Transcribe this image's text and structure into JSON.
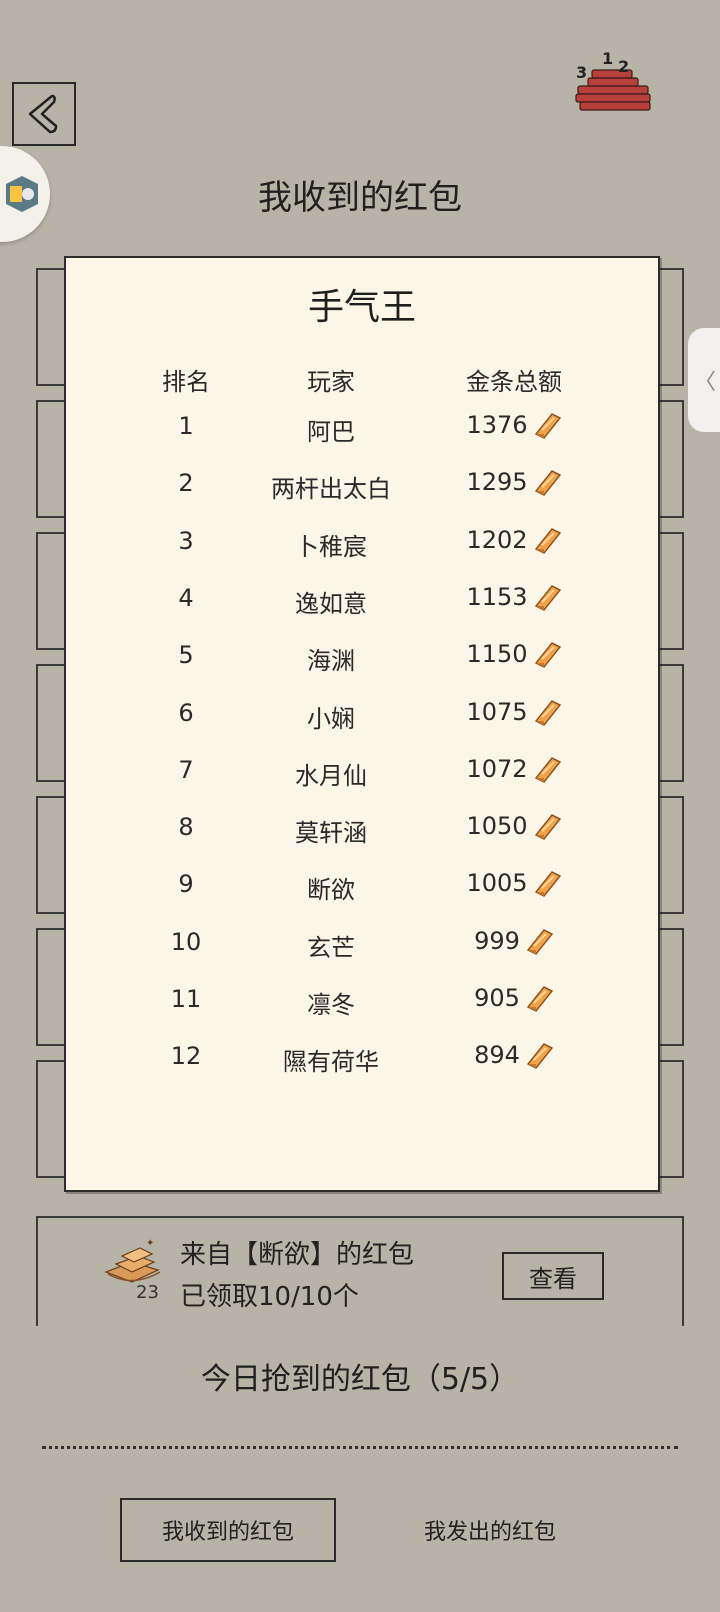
{
  "header": {
    "title": "我收到的红包",
    "back_icon": "back-arrow-icon",
    "rank_icon": "ranking-podium-icon",
    "rank_digits": [
      "3",
      "1",
      "2"
    ]
  },
  "leaderboard": {
    "title": "手气王",
    "columns": [
      "排名",
      "玩家",
      "金条总额"
    ],
    "currency_icon": "gold-bar-icon",
    "rows": [
      {
        "rank": "1",
        "player": "阿巴",
        "amount": "1376"
      },
      {
        "rank": "2",
        "player": "两杆出太白",
        "amount": "1295"
      },
      {
        "rank": "3",
        "player": "卜稚宸",
        "amount": "1202"
      },
      {
        "rank": "4",
        "player": "逸如意",
        "amount": "1153"
      },
      {
        "rank": "5",
        "player": "海渊",
        "amount": "1150"
      },
      {
        "rank": "6",
        "player": "小娴",
        "amount": "1075"
      },
      {
        "rank": "7",
        "player": "水月仙",
        "amount": "1072"
      },
      {
        "rank": "8",
        "player": "莫轩涵",
        "amount": "1050"
      },
      {
        "rank": "9",
        "player": "断欲",
        "amount": "1005"
      },
      {
        "rank": "10",
        "player": "玄芒",
        "amount": "999"
      },
      {
        "rank": "11",
        "player": "凛冬",
        "amount": "905"
      },
      {
        "rank": "12",
        "player": "隰有荷华",
        "amount": "894"
      }
    ]
  },
  "packet": {
    "icon": "gold-pile-icon",
    "count": "23",
    "from": "来自【断欲】的红包",
    "status": "已领取10/10个",
    "view_label": "查看"
  },
  "today": {
    "label": "今日抢到的红包（5/5）"
  },
  "tabs": {
    "received": "我收到的红包",
    "sent": "我发出的红包"
  },
  "colors": {
    "background": "#b7b3a7",
    "paper": "#fcf6e8",
    "gold": "#f0a24a"
  }
}
